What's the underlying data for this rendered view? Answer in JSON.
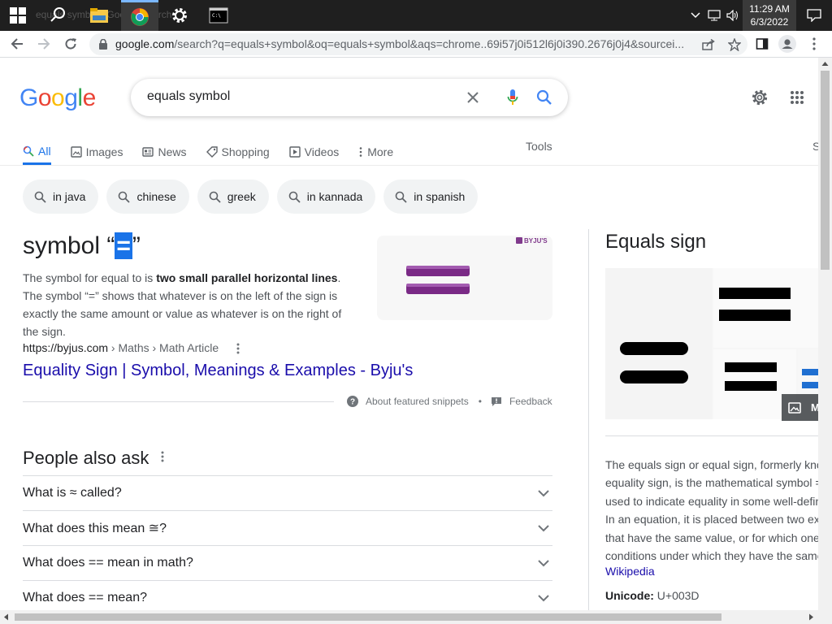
{
  "taskbar": {
    "ghost_title": "equals symbol - Google Search",
    "clock_time": "11:29 AM",
    "clock_date": "6/3/2022"
  },
  "browser": {
    "url_host": "google.com",
    "url_rest": "/search?q=equals+symbol&oq=equals+symbol&aqs=chrome..69i57j0i512l6j0i390.2676j0j4&sourcei..."
  },
  "header": {
    "logo_letters": [
      "G",
      "o",
      "o",
      "g",
      "l",
      "e"
    ],
    "logo_colors": [
      "#4285f4",
      "#ea4335",
      "#fbbc05",
      "#4285f4",
      "#34a853",
      "#ea4335"
    ],
    "query": "equals symbol"
  },
  "tabs": [
    {
      "label": "All",
      "icon": "search-icon"
    },
    {
      "label": "Images",
      "icon": "image-icon"
    },
    {
      "label": "News",
      "icon": "news-icon"
    },
    {
      "label": "Shopping",
      "icon": "tag-icon"
    },
    {
      "label": "Videos",
      "icon": "play-icon"
    },
    {
      "label": "More",
      "icon": "more-vert-icon"
    }
  ],
  "tools_label": "Tools",
  "truncated_tab_label": "S",
  "chips": [
    "in java",
    "chinese",
    "greek",
    "in kannada",
    "in spanish"
  ],
  "snippet": {
    "title_before": "symbol “",
    "title_highlight": "=",
    "title_after": "”",
    "text_before": "The symbol for equal to is ",
    "text_bold": "two small parallel horizontal lines",
    "text_after": ". The symbol “=” shows that whatever is on the left of the sign is exactly the same amount or value as whatever is on the right of the sign.",
    "image_brand": "BYJU'S",
    "source_url": "https://byjus.com",
    "source_crumbs": " › Maths › Math Article",
    "source_title": "Equality Sign | Symbol, Meanings & Examples - Byju's",
    "about_label": "About featured snippets",
    "bullet": "•",
    "feedback_label": "Feedback"
  },
  "people_also_ask": {
    "title": "People also ask",
    "questions": [
      "What is ≈ called?",
      "What does this mean ≅?",
      "What does == mean in math?",
      "What does == mean?"
    ]
  },
  "knowledge_panel": {
    "title": "Equals sign",
    "more_images_label": "M",
    "description_lines": [
      "The equals sign or equal sign, formerly kno",
      "equality sign, is the mathematical symbol =",
      "used to indicate equality in some well-defin",
      "In an equation, it is placed between two ex",
      "that have the same value, or for which one",
      "conditions under which they have the same"
    ],
    "source_link": "Wikipedia",
    "unicode_label": "Unicode:",
    "unicode_value": "U+003D"
  }
}
